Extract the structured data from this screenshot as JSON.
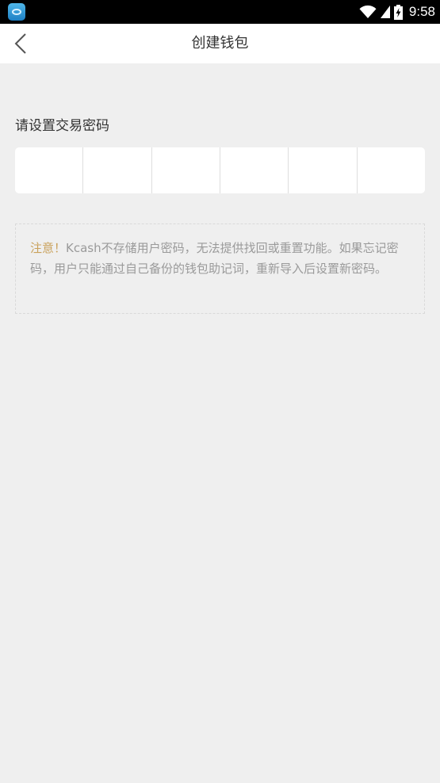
{
  "status_bar": {
    "time": "9:58",
    "icons": [
      "app-icon",
      "wifi-icon",
      "signal-icon",
      "battery-icon"
    ]
  },
  "header": {
    "back_icon": "chevron-left-icon",
    "title": "创建钱包"
  },
  "password": {
    "label": "请设置交易密码",
    "digit_count": 6
  },
  "notice": {
    "label": "注意！",
    "text": "Kcash不存储用户密码，无法提供找回或重置功能。如果忘记密码，用户只能通过自己备份的钱包助记词，重新导入后设置新密码。",
    "label_color": "#c9a15b"
  }
}
